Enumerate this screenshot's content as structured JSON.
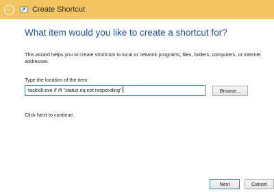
{
  "window": {
    "title": "Create Shortcut",
    "back_icon": "back-arrow-icon",
    "app_icon": "shortcut-icon",
    "titlebar_color": "#f3c560"
  },
  "main": {
    "heading": "What item would you like to create a shortcut for?",
    "description": "This wizard helps you to create shortcuts to local or network programs, files, folders, computers, or Internet addresses.",
    "location_label": "Type the location of the item:",
    "location_value": "taskkill.exe /f /fi \"status eq not responding\"",
    "browse_label": "Browse...",
    "hint": "Click Next to continue."
  },
  "footer": {
    "next_label": "Next",
    "cancel_label": "Cancel"
  }
}
